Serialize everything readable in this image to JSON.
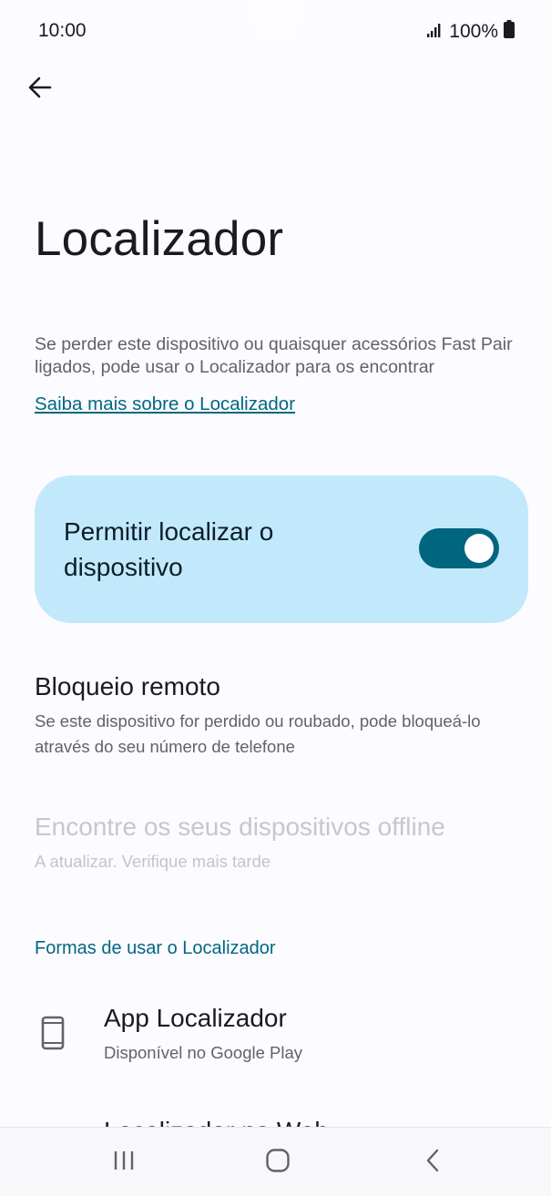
{
  "status_bar": {
    "time": "10:00",
    "battery": "100%",
    "icons": [
      "signal-icon",
      "battery-icon"
    ]
  },
  "header": {
    "back_icon": "arrow-back-icon",
    "title": "Localizador"
  },
  "intro": {
    "description": "Se perder este dispositivo ou quaisquer acessórios Fast Pair ligados, pode usar o Localizador para os encontrar",
    "learn_more_link": "Saiba mais sobre o Localizador"
  },
  "main_toggle": {
    "label": "Permitir localizar o dispositivo",
    "state": "on",
    "card_color": "#c2e8fb",
    "switch_color": "#00657f"
  },
  "settings": [
    {
      "title": "Bloqueio remoto",
      "subtitle": "Se este dispositivo for perdido ou roubado, pode bloqueá-lo através do seu número de telefone",
      "enabled": true
    },
    {
      "title": "Encontre os seus dispositivos offline",
      "subtitle": "A atualizar. Verifique mais tarde",
      "enabled": false
    }
  ],
  "ways_section": {
    "header": "Formas de usar o Localizador",
    "items": [
      {
        "icon": "phone-icon",
        "title": "App Localizador",
        "subtitle": "Disponível no Google Play"
      }
    ],
    "partial_item_title": "Localizador na Web"
  },
  "nav_bar": {
    "icons": [
      "recent-apps-icon",
      "home-icon",
      "back-nav-icon"
    ]
  },
  "colors": {
    "accent": "#006782",
    "background": "#fcfbff"
  }
}
